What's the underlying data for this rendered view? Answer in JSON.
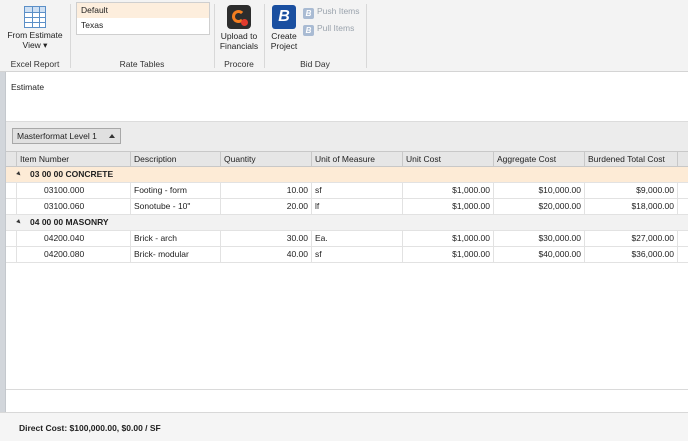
{
  "ribbon": {
    "excel_report": {
      "label": "Excel Report",
      "from_estimate_line1": "From Estimate",
      "from_estimate_line2": "View ▾"
    },
    "rate_tables": {
      "label": "Rate Tables",
      "items": [
        "Default",
        "Texas"
      ]
    },
    "procore": {
      "label": "Procore",
      "upload_line1": "Upload to",
      "upload_line2": "Financials"
    },
    "bid_day": {
      "label": "Bid Day",
      "create_line1": "Create",
      "create_line2": "Project",
      "push_items": "Push Items",
      "pull_items": "Pull Items"
    }
  },
  "estimate": {
    "title": "Estimate",
    "group_by": "Masterformat Level 1",
    "columns": [
      "Item Number",
      "Description",
      "Quantity",
      "Unit of Measure",
      "Unit Cost",
      "Aggregate Cost",
      "Burdened Total Cost"
    ],
    "groups": [
      {
        "title": "03 00 00 CONCRETE",
        "rows": [
          [
            "03100.000",
            "Footing - form",
            "10.00",
            "sf",
            "$1,000.00",
            "$10,000.00",
            "$9,000.00"
          ],
          [
            "03100.060",
            "Sonotube - 10\"",
            "20.00",
            "lf",
            "$1,000.00",
            "$20,000.00",
            "$18,000.00"
          ]
        ]
      },
      {
        "title": "04 00 00 MASONRY",
        "rows": [
          [
            "04200.040",
            "Brick - arch",
            "30.00",
            "Ea.",
            "$1,000.00",
            "$30,000.00",
            "$27,000.00"
          ],
          [
            "04200.080",
            "Brick- modular",
            "40.00",
            "sf",
            "$1,000.00",
            "$40,000.00",
            "$36,000.00"
          ]
        ]
      }
    ]
  },
  "footer": {
    "direct_cost": "Direct Cost: $100,000.00, $0.00 / SF"
  },
  "colors": {
    "group_highlight": "#fdebd6",
    "accent_blue": "#1a4fa0",
    "procore_orange": "#f47e20"
  }
}
